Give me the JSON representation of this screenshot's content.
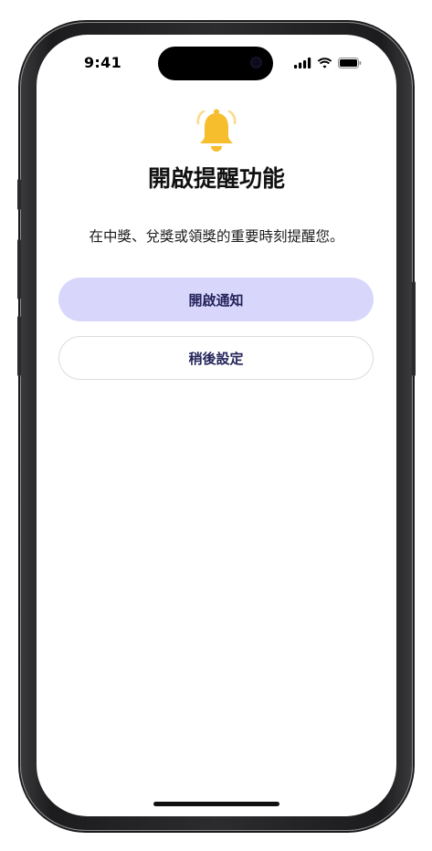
{
  "status_bar": {
    "time": "9:41",
    "signal_icon": "cellular-signal-icon",
    "wifi_icon": "wifi-icon",
    "battery_icon": "battery-icon"
  },
  "content": {
    "icon": "bell-ringing-icon",
    "icon_color": "#F6BE2C",
    "title": "開啟提醒功能",
    "description": "在中獎、兌獎或領獎的重要時刻提醒您。"
  },
  "buttons": {
    "primary_label": "開啟通知",
    "primary_color": "#D8D6FB",
    "secondary_label": "稍後設定",
    "label_color": "#23235A"
  }
}
